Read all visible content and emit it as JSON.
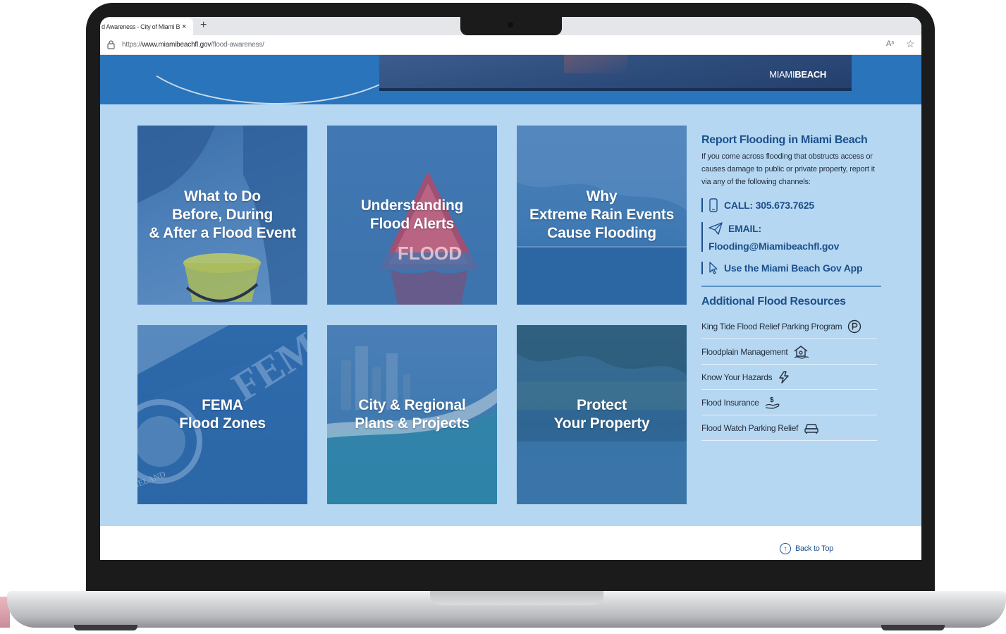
{
  "browser": {
    "tab_title": "d Awareness - City of Miami B",
    "tab_close": "×",
    "new_tab": "+",
    "url_prefix": "https://",
    "url_domain": "www.miamibeachfl.gov",
    "url_path": "/flood-awareness/",
    "read_aloud": "Aˢ",
    "favorite": "☆"
  },
  "hero": {
    "logo_light": "MIAMI",
    "logo_bold": "BEACH"
  },
  "tiles": [
    {
      "label": "What to Do\nBefore, During\n& After a Flood Event"
    },
    {
      "label": "Understanding\nFlood Alerts"
    },
    {
      "label": "Why\nExtreme Rain Events\nCause Flooding"
    },
    {
      "label": "FEMA\nFlood Zones"
    },
    {
      "label": "City & Regional\nPlans & Projects"
    },
    {
      "label": "Protect\nYour Property"
    }
  ],
  "tile_deco": {
    "flood_sign": "FLOOD",
    "fema": "FEMA",
    "seal": "MELAND"
  },
  "report": {
    "heading": "Report Flooding in Miami Beach",
    "body": "If you come across flooding that obstructs access or causes damage to public or private property, report it via any of the following channels:",
    "call": "CALL: 305.673.7625",
    "email_label": "EMAIL:",
    "email": "Flooding@Miamibeachfl.gov",
    "app": "Use the Miami Beach Gov App"
  },
  "resources": {
    "heading": "Additional Flood Resources",
    "items": [
      {
        "label": "King Tide Flood Relief Parking Program",
        "icon": "parking-icon"
      },
      {
        "label": "Floodplain Management",
        "icon": "house-icon"
      },
      {
        "label": "Know Your Hazards",
        "icon": "hazard-icon"
      },
      {
        "label": "Flood Insurance",
        "icon": "insurance-icon"
      },
      {
        "label": "Flood Watch Parking Relief",
        "icon": "car-icon"
      }
    ]
  },
  "footer": {
    "back_to_top": "Back to Top",
    "up_arrow": "↑"
  },
  "colors": {
    "brand_blue": "#1b4f8d",
    "page_bg": "#b6d7f1",
    "hero_blue": "#2a74bb"
  }
}
